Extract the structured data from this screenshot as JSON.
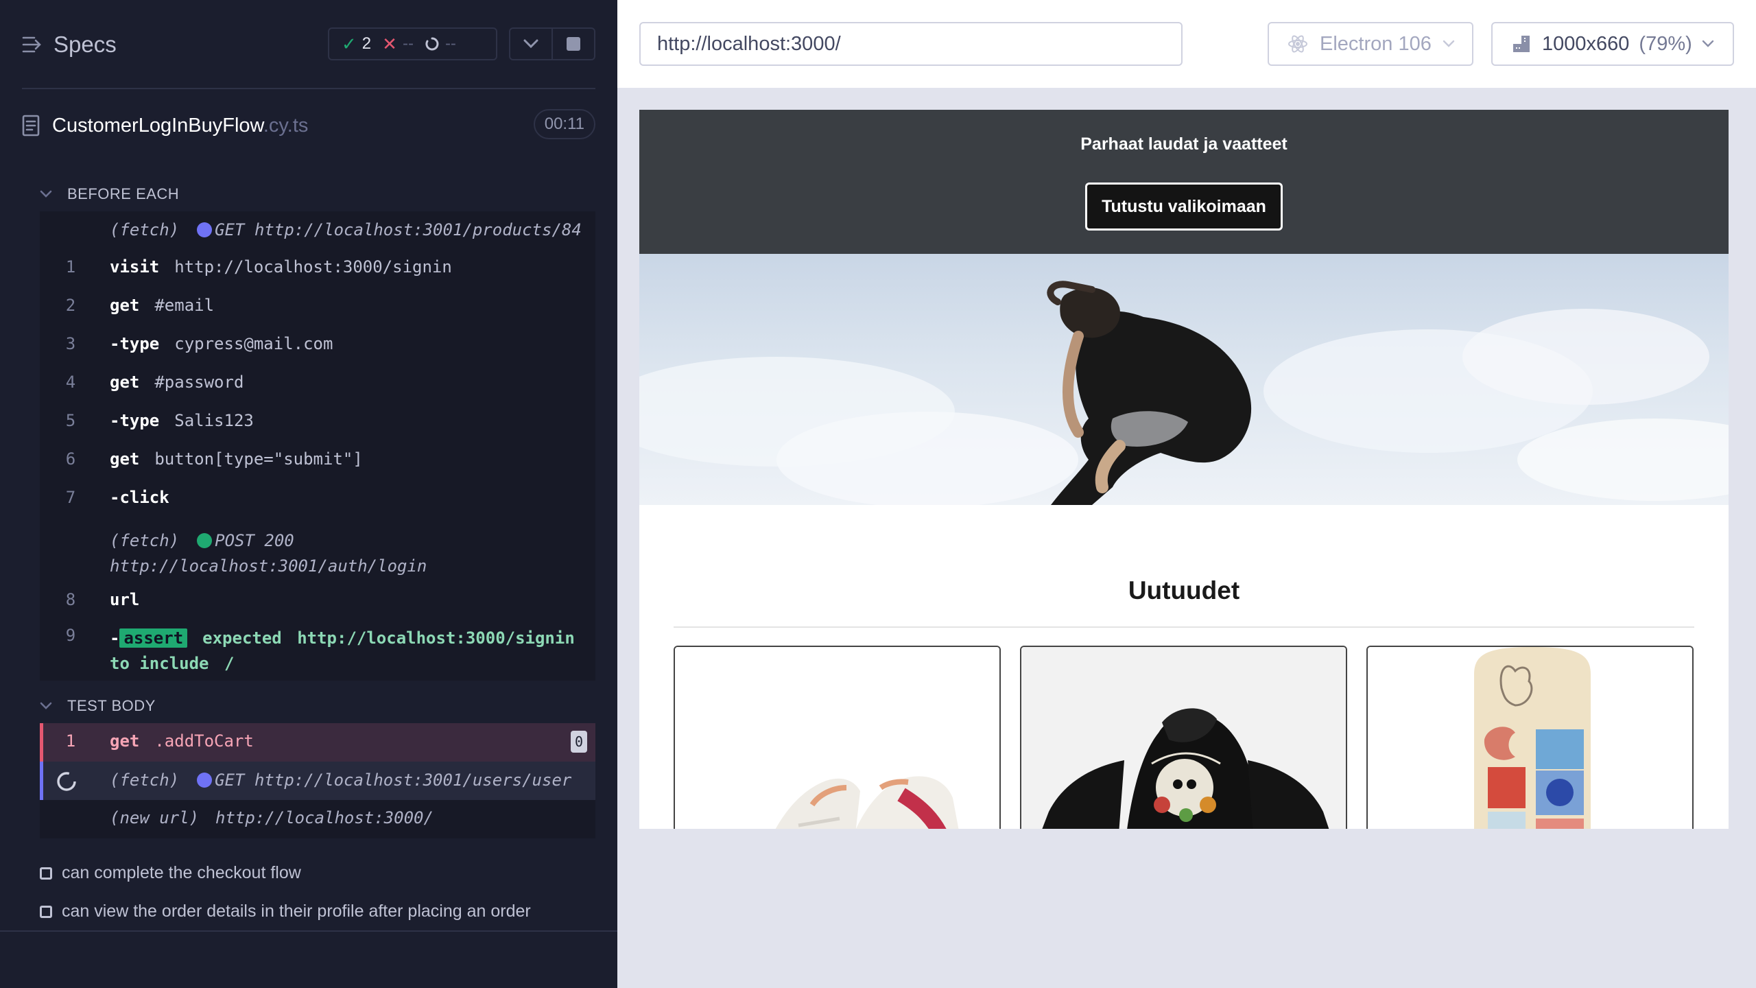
{
  "reporter": {
    "specs_label": "Specs",
    "stats": {
      "passed": "2",
      "failed": "--",
      "pending": "--"
    },
    "spec": {
      "name": "CustomerLogInBuyFlow",
      "ext": ".cy.ts",
      "duration": "00:11"
    },
    "before_each": {
      "title": "BEFORE EACH",
      "commands": [
        {
          "num": "",
          "kind": "fetch",
          "prefix": "(fetch)",
          "method": "GET",
          "url": "http://localhost:3001/products/84"
        },
        {
          "num": "1",
          "name": "visit",
          "message": "http://localhost:3000/signin"
        },
        {
          "num": "2",
          "name": "get",
          "message": "#email"
        },
        {
          "num": "3",
          "name": "-type",
          "message": "cypress@mail.com"
        },
        {
          "num": "4",
          "name": "get",
          "message": "#password"
        },
        {
          "num": "5",
          "name": "-type",
          "message": "Salis123"
        },
        {
          "num": "6",
          "name": "get",
          "message": "button[type=\"submit\"]"
        },
        {
          "num": "7",
          "name": "-click",
          "message": ""
        },
        {
          "num": "",
          "kind": "fetch",
          "prefix": "(fetch)",
          "method": "POST 200",
          "url": "http://localhost:3001/auth/login"
        },
        {
          "num": "8",
          "name": "url",
          "message": ""
        },
        {
          "num": "9",
          "name": "-",
          "badge": "assert",
          "line1": "expected",
          "line1_url": "http://localhost:3000/signin",
          "line2": "to include",
          "line2_val": "/"
        }
      ]
    },
    "test_body": {
      "title": "TEST BODY",
      "commands": [
        {
          "num": "1",
          "name": "get",
          "message": ".addToCart",
          "count": "0"
        },
        {
          "num": "",
          "kind": "fetch",
          "prefix": "(fetch)",
          "method": "GET",
          "url": "http://localhost:3001/users/user"
        },
        {
          "num": "",
          "kind": "newurl",
          "prefix": "(new url)",
          "url": "http://localhost:3000/"
        }
      ]
    },
    "tests": [
      {
        "label": "can complete the checkout flow"
      },
      {
        "label": "can view the order details in their profile after placing an order"
      }
    ]
  },
  "app": {
    "url": "http://localhost:3000/",
    "browser": "Electron 106",
    "viewport": "1000x660",
    "viewport_scale": "(79%)"
  },
  "aut": {
    "hero_title": "Parhaat laudat ja vaatteet",
    "hero_button": "Tutustu valikoimaan",
    "section_title": "Uutuudet"
  },
  "colors": {
    "reporter_bg": "#1b1e2e",
    "pass": "#1fa971",
    "fail": "#e45770",
    "request_dot": "#6f72f5",
    "active_command": "#3b2a3e"
  }
}
